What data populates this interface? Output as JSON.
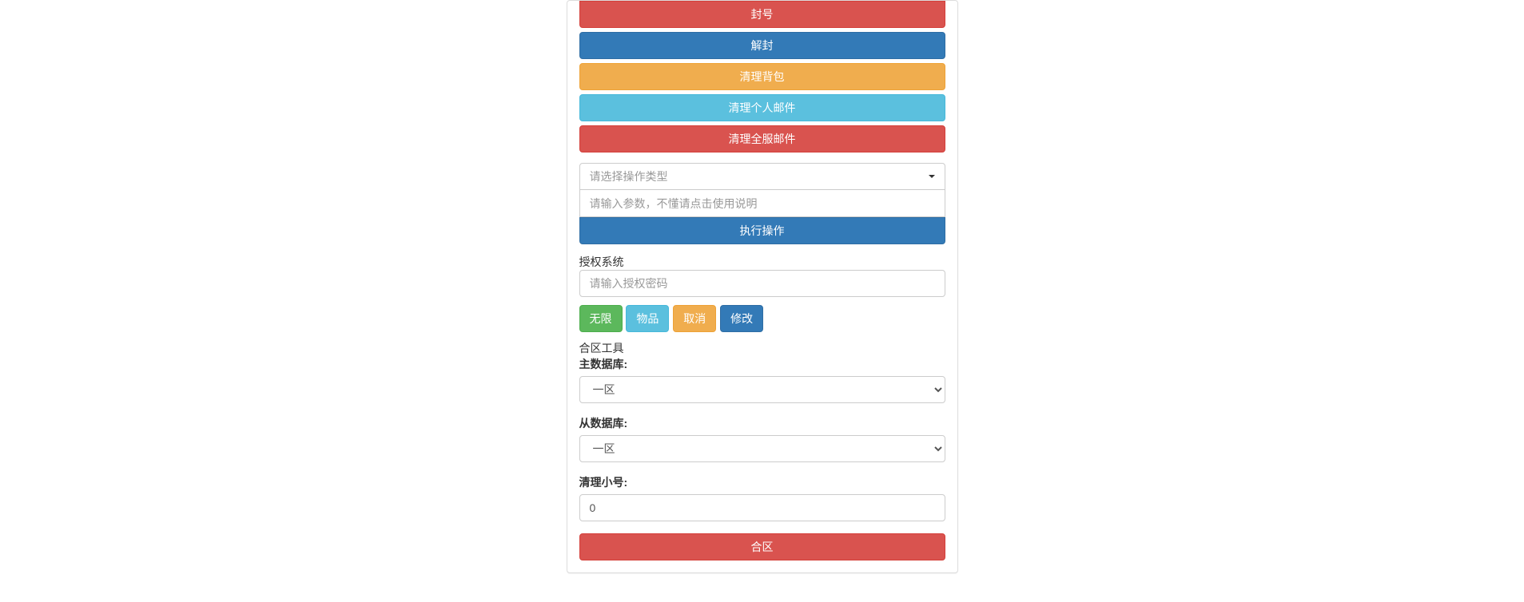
{
  "actions": {
    "ban": "封号",
    "unban": "解封",
    "clear_bag": "清理背包",
    "clear_personal_mail": "清理个人邮件",
    "clear_server_mail": "清理全服邮件"
  },
  "operation": {
    "type_placeholder": "请选择操作类型",
    "param_placeholder": "请输入参数，不懂请点击使用说明",
    "execute": "执行操作"
  },
  "auth": {
    "label": "授权系统",
    "password_placeholder": "请输入授权密码",
    "unlimited": "无限",
    "item": "物品",
    "cancel": "取消",
    "modify": "修改"
  },
  "merge": {
    "title": "合区工具",
    "main_db_label": "主数据库:",
    "sub_db_label": "从数据库:",
    "clear_alt_label": "清理小号:",
    "option": "一区",
    "clear_value": "0",
    "merge_btn": "合区"
  }
}
